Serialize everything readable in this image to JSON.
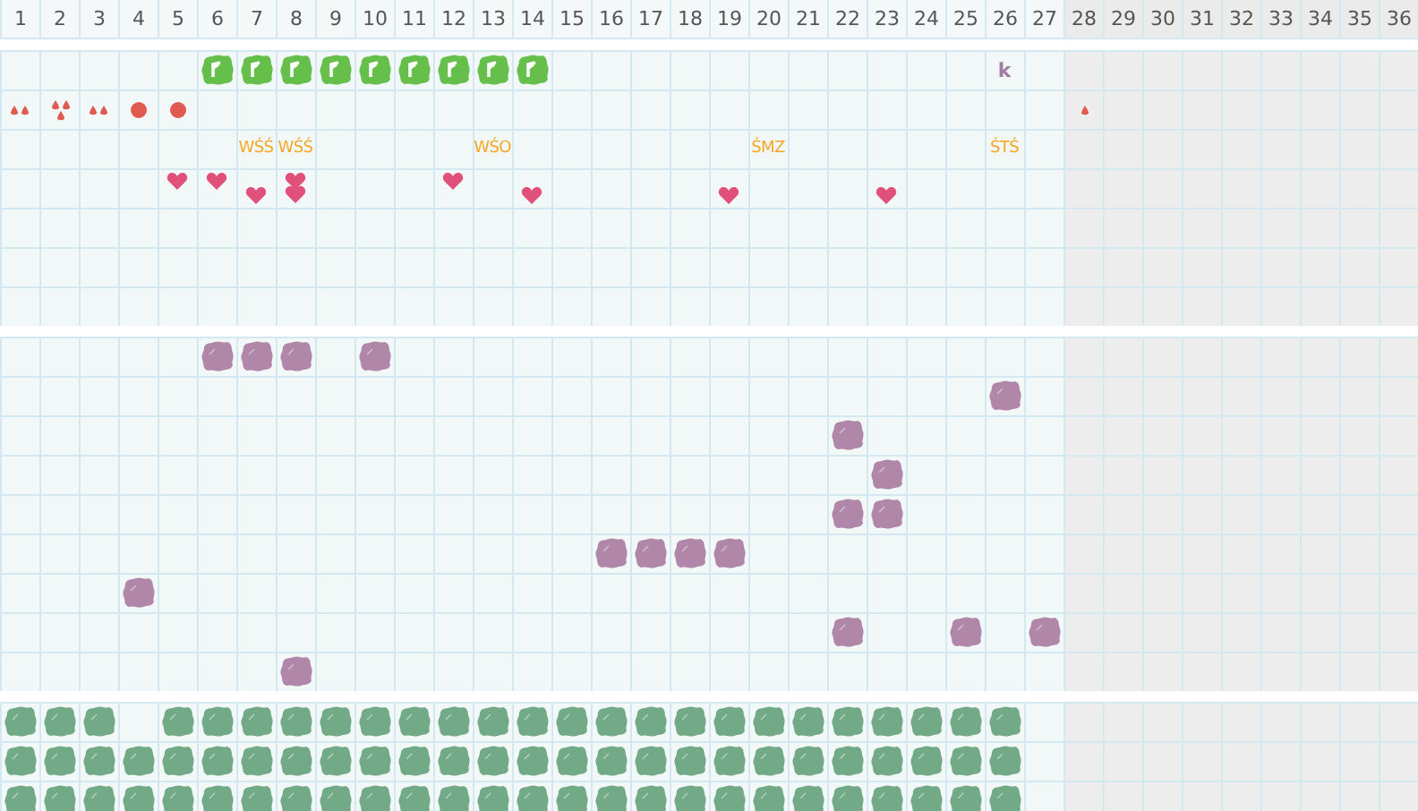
{
  "columns": [
    {
      "label": "1",
      "shaded": false
    },
    {
      "label": "2",
      "shaded": false
    },
    {
      "label": "3",
      "shaded": false
    },
    {
      "label": "4",
      "shaded": false
    },
    {
      "label": "5",
      "shaded": false
    },
    {
      "label": "6",
      "shaded": false
    },
    {
      "label": "7",
      "shaded": false
    },
    {
      "label": "8",
      "shaded": false
    },
    {
      "label": "9",
      "shaded": false
    },
    {
      "label": "10",
      "shaded": false
    },
    {
      "label": "11",
      "shaded": false
    },
    {
      "label": "12",
      "shaded": false
    },
    {
      "label": "13",
      "shaded": false
    },
    {
      "label": "14",
      "shaded": false
    },
    {
      "label": "15",
      "shaded": false
    },
    {
      "label": "16",
      "shaded": false
    },
    {
      "label": "17",
      "shaded": false
    },
    {
      "label": "18",
      "shaded": false
    },
    {
      "label": "19",
      "shaded": false
    },
    {
      "label": "20",
      "shaded": false
    },
    {
      "label": "21",
      "shaded": false
    },
    {
      "label": "22",
      "shaded": false
    },
    {
      "label": "23",
      "shaded": false
    },
    {
      "label": "24",
      "shaded": false
    },
    {
      "label": "25",
      "shaded": false
    },
    {
      "label": "26",
      "shaded": false
    },
    {
      "label": "27",
      "shaded": false
    },
    {
      "label": "28",
      "shaded": true
    },
    {
      "label": "29",
      "shaded": true
    },
    {
      "label": "30",
      "shaded": true
    },
    {
      "label": "31",
      "shaded": true
    },
    {
      "label": "32",
      "shaded": true
    },
    {
      "label": "33",
      "shaded": true
    },
    {
      "label": "34",
      "shaded": true
    },
    {
      "label": "35",
      "shaded": true
    },
    {
      "label": "36",
      "shaded": true
    }
  ],
  "sections": [
    {
      "rows": [
        {
          "cells": [
            {
              "kind": "empty"
            },
            {
              "kind": "empty"
            },
            {
              "kind": "empty"
            },
            {
              "kind": "empty"
            },
            {
              "kind": "empty"
            },
            {
              "kind": "tile"
            },
            {
              "kind": "tile"
            },
            {
              "kind": "tile"
            },
            {
              "kind": "tile"
            },
            {
              "kind": "tile"
            },
            {
              "kind": "tile"
            },
            {
              "kind": "tile"
            },
            {
              "kind": "tile"
            },
            {
              "kind": "tile"
            },
            {
              "kind": "empty"
            },
            {
              "kind": "empty"
            },
            {
              "kind": "empty"
            },
            {
              "kind": "empty"
            },
            {
              "kind": "empty"
            },
            {
              "kind": "empty"
            },
            {
              "kind": "empty"
            },
            {
              "kind": "empty"
            },
            {
              "kind": "empty"
            },
            {
              "kind": "empty"
            },
            {
              "kind": "empty"
            },
            {
              "kind": "letter",
              "text": "k"
            }
          ]
        },
        {
          "cells": [
            {
              "kind": "drop-pair"
            },
            {
              "kind": "drop-triple"
            },
            {
              "kind": "drop-pair"
            },
            {
              "kind": "dot"
            },
            {
              "kind": "dot"
            },
            {
              "kind": "empty"
            },
            {
              "kind": "empty"
            },
            {
              "kind": "empty"
            },
            {
              "kind": "empty"
            },
            {
              "kind": "empty"
            },
            {
              "kind": "empty"
            },
            {
              "kind": "empty"
            },
            {
              "kind": "empty"
            },
            {
              "kind": "empty"
            },
            {
              "kind": "empty"
            },
            {
              "kind": "empty"
            },
            {
              "kind": "empty"
            },
            {
              "kind": "empty"
            },
            {
              "kind": "empty"
            },
            {
              "kind": "empty"
            },
            {
              "kind": "empty"
            },
            {
              "kind": "empty"
            },
            {
              "kind": "empty"
            },
            {
              "kind": "empty"
            },
            {
              "kind": "empty"
            },
            {
              "kind": "empty"
            },
            {
              "kind": "empty"
            },
            {
              "kind": "drop"
            }
          ]
        },
        {
          "cells": [
            {
              "kind": "empty"
            },
            {
              "kind": "empty"
            },
            {
              "kind": "empty"
            },
            {
              "kind": "empty"
            },
            {
              "kind": "empty"
            },
            {
              "kind": "empty"
            },
            {
              "kind": "label",
              "text": "WŚŚ"
            },
            {
              "kind": "label",
              "text": "WŚŚ"
            },
            {
              "kind": "empty"
            },
            {
              "kind": "empty"
            },
            {
              "kind": "empty"
            },
            {
              "kind": "empty"
            },
            {
              "kind": "label",
              "text": "WŚO"
            },
            {
              "kind": "empty"
            },
            {
              "kind": "empty"
            },
            {
              "kind": "empty"
            },
            {
              "kind": "empty"
            },
            {
              "kind": "empty"
            },
            {
              "kind": "empty"
            },
            {
              "kind": "label",
              "text": "ŚMZ"
            },
            {
              "kind": "empty"
            },
            {
              "kind": "empty"
            },
            {
              "kind": "empty"
            },
            {
              "kind": "empty"
            },
            {
              "kind": "empty"
            },
            {
              "kind": "label",
              "text": "ŚTŚ"
            }
          ]
        },
        {
          "cells": [
            {
              "kind": "empty"
            },
            {
              "kind": "empty"
            },
            {
              "kind": "empty"
            },
            {
              "kind": "empty"
            },
            {
              "kind": "heart"
            },
            {
              "kind": "heart"
            },
            {
              "kind": "heart-low"
            },
            {
              "kind": "heart-pair"
            },
            {
              "kind": "empty"
            },
            {
              "kind": "empty"
            },
            {
              "kind": "empty"
            },
            {
              "kind": "heart"
            },
            {
              "kind": "empty"
            },
            {
              "kind": "heart-low"
            },
            {
              "kind": "empty"
            },
            {
              "kind": "empty"
            },
            {
              "kind": "empty"
            },
            {
              "kind": "empty"
            },
            {
              "kind": "heart-low"
            },
            {
              "kind": "empty"
            },
            {
              "kind": "empty"
            },
            {
              "kind": "empty"
            },
            {
              "kind": "heart-low"
            }
          ]
        },
        {},
        {},
        {}
      ]
    },
    {
      "rows": [
        {
          "cells": [
            {
              "kind": "empty"
            },
            {
              "kind": "empty"
            },
            {
              "kind": "empty"
            },
            {
              "kind": "empty"
            },
            {
              "kind": "empty"
            },
            {
              "kind": "blob"
            },
            {
              "kind": "blob"
            },
            {
              "kind": "blob"
            },
            {
              "kind": "empty"
            },
            {
              "kind": "blob"
            }
          ]
        },
        {
          "cells": [
            {
              "kind": "empty"
            },
            {
              "kind": "empty"
            },
            {
              "kind": "empty"
            },
            {
              "kind": "empty"
            },
            {
              "kind": "empty"
            },
            {
              "kind": "empty"
            },
            {
              "kind": "empty"
            },
            {
              "kind": "empty"
            },
            {
              "kind": "empty"
            },
            {
              "kind": "empty"
            },
            {
              "kind": "empty"
            },
            {
              "kind": "empty"
            },
            {
              "kind": "empty"
            },
            {
              "kind": "empty"
            },
            {
              "kind": "empty"
            },
            {
              "kind": "empty"
            },
            {
              "kind": "empty"
            },
            {
              "kind": "empty"
            },
            {
              "kind": "empty"
            },
            {
              "kind": "empty"
            },
            {
              "kind": "empty"
            },
            {
              "kind": "empty"
            },
            {
              "kind": "empty"
            },
            {
              "kind": "empty"
            },
            {
              "kind": "empty"
            },
            {
              "kind": "blob"
            }
          ]
        },
        {
          "cells": [
            {
              "kind": "empty"
            },
            {
              "kind": "empty"
            },
            {
              "kind": "empty"
            },
            {
              "kind": "empty"
            },
            {
              "kind": "empty"
            },
            {
              "kind": "empty"
            },
            {
              "kind": "empty"
            },
            {
              "kind": "empty"
            },
            {
              "kind": "empty"
            },
            {
              "kind": "empty"
            },
            {
              "kind": "empty"
            },
            {
              "kind": "empty"
            },
            {
              "kind": "empty"
            },
            {
              "kind": "empty"
            },
            {
              "kind": "empty"
            },
            {
              "kind": "empty"
            },
            {
              "kind": "empty"
            },
            {
              "kind": "empty"
            },
            {
              "kind": "empty"
            },
            {
              "kind": "empty"
            },
            {
              "kind": "empty"
            },
            {
              "kind": "blob"
            }
          ]
        },
        {
          "cells": [
            {
              "kind": "empty"
            },
            {
              "kind": "empty"
            },
            {
              "kind": "empty"
            },
            {
              "kind": "empty"
            },
            {
              "kind": "empty"
            },
            {
              "kind": "empty"
            },
            {
              "kind": "empty"
            },
            {
              "kind": "empty"
            },
            {
              "kind": "empty"
            },
            {
              "kind": "empty"
            },
            {
              "kind": "empty"
            },
            {
              "kind": "empty"
            },
            {
              "kind": "empty"
            },
            {
              "kind": "empty"
            },
            {
              "kind": "empty"
            },
            {
              "kind": "empty"
            },
            {
              "kind": "empty"
            },
            {
              "kind": "empty"
            },
            {
              "kind": "empty"
            },
            {
              "kind": "empty"
            },
            {
              "kind": "empty"
            },
            {
              "kind": "empty"
            },
            {
              "kind": "blob"
            }
          ]
        },
        {
          "cells": [
            {
              "kind": "empty"
            },
            {
              "kind": "empty"
            },
            {
              "kind": "empty"
            },
            {
              "kind": "empty"
            },
            {
              "kind": "empty"
            },
            {
              "kind": "empty"
            },
            {
              "kind": "empty"
            },
            {
              "kind": "empty"
            },
            {
              "kind": "empty"
            },
            {
              "kind": "empty"
            },
            {
              "kind": "empty"
            },
            {
              "kind": "empty"
            },
            {
              "kind": "empty"
            },
            {
              "kind": "empty"
            },
            {
              "kind": "empty"
            },
            {
              "kind": "empty"
            },
            {
              "kind": "empty"
            },
            {
              "kind": "empty"
            },
            {
              "kind": "empty"
            },
            {
              "kind": "empty"
            },
            {
              "kind": "empty"
            },
            {
              "kind": "blob"
            },
            {
              "kind": "blob"
            }
          ]
        },
        {
          "cells": [
            {
              "kind": "empty"
            },
            {
              "kind": "empty"
            },
            {
              "kind": "empty"
            },
            {
              "kind": "empty"
            },
            {
              "kind": "empty"
            },
            {
              "kind": "empty"
            },
            {
              "kind": "empty"
            },
            {
              "kind": "empty"
            },
            {
              "kind": "empty"
            },
            {
              "kind": "empty"
            },
            {
              "kind": "empty"
            },
            {
              "kind": "empty"
            },
            {
              "kind": "empty"
            },
            {
              "kind": "empty"
            },
            {
              "kind": "empty"
            },
            {
              "kind": "blob"
            },
            {
              "kind": "blob"
            },
            {
              "kind": "blob"
            },
            {
              "kind": "blob"
            }
          ]
        },
        {
          "cells": [
            {
              "kind": "empty"
            },
            {
              "kind": "empty"
            },
            {
              "kind": "empty"
            },
            {
              "kind": "blob"
            }
          ]
        },
        {
          "cells": [
            {
              "kind": "empty"
            },
            {
              "kind": "empty"
            },
            {
              "kind": "empty"
            },
            {
              "kind": "empty"
            },
            {
              "kind": "empty"
            },
            {
              "kind": "empty"
            },
            {
              "kind": "empty"
            },
            {
              "kind": "empty"
            },
            {
              "kind": "empty"
            },
            {
              "kind": "empty"
            },
            {
              "kind": "empty"
            },
            {
              "kind": "empty"
            },
            {
              "kind": "empty"
            },
            {
              "kind": "empty"
            },
            {
              "kind": "empty"
            },
            {
              "kind": "empty"
            },
            {
              "kind": "empty"
            },
            {
              "kind": "empty"
            },
            {
              "kind": "empty"
            },
            {
              "kind": "empty"
            },
            {
              "kind": "empty"
            },
            {
              "kind": "blob"
            },
            {
              "kind": "empty"
            },
            {
              "kind": "empty"
            },
            {
              "kind": "blob"
            },
            {
              "kind": "empty"
            },
            {
              "kind": "blob"
            }
          ]
        },
        {
          "cells": [
            {
              "kind": "empty"
            },
            {
              "kind": "empty"
            },
            {
              "kind": "empty"
            },
            {
              "kind": "empty"
            },
            {
              "kind": "empty"
            },
            {
              "kind": "empty"
            },
            {
              "kind": "empty"
            },
            {
              "kind": "blob"
            }
          ]
        }
      ]
    },
    {
      "rows": [
        {
          "cells": [
            {
              "kind": "leaf"
            },
            {
              "kind": "leaf"
            },
            {
              "kind": "leaf"
            },
            {
              "kind": "empty"
            },
            {
              "kind": "leaf"
            },
            {
              "kind": "leaf"
            },
            {
              "kind": "leaf"
            },
            {
              "kind": "leaf"
            },
            {
              "kind": "leaf"
            },
            {
              "kind": "leaf"
            },
            {
              "kind": "leaf"
            },
            {
              "kind": "leaf"
            },
            {
              "kind": "leaf"
            },
            {
              "kind": "leaf"
            },
            {
              "kind": "leaf"
            },
            {
              "kind": "leaf"
            },
            {
              "kind": "leaf"
            },
            {
              "kind": "leaf"
            },
            {
              "kind": "leaf"
            },
            {
              "kind": "leaf"
            },
            {
              "kind": "leaf"
            },
            {
              "kind": "leaf"
            },
            {
              "kind": "leaf"
            },
            {
              "kind": "leaf"
            },
            {
              "kind": "leaf"
            },
            {
              "kind": "leaf"
            }
          ]
        },
        {
          "cells": [
            {
              "kind": "leaf"
            },
            {
              "kind": "leaf"
            },
            {
              "kind": "leaf"
            },
            {
              "kind": "leaf"
            },
            {
              "kind": "leaf"
            },
            {
              "kind": "leaf"
            },
            {
              "kind": "leaf"
            },
            {
              "kind": "leaf"
            },
            {
              "kind": "leaf"
            },
            {
              "kind": "leaf"
            },
            {
              "kind": "leaf"
            },
            {
              "kind": "leaf"
            },
            {
              "kind": "leaf"
            },
            {
              "kind": "leaf"
            },
            {
              "kind": "leaf"
            },
            {
              "kind": "leaf"
            },
            {
              "kind": "leaf"
            },
            {
              "kind": "leaf"
            },
            {
              "kind": "leaf"
            },
            {
              "kind": "leaf"
            },
            {
              "kind": "leaf"
            },
            {
              "kind": "leaf"
            },
            {
              "kind": "leaf"
            },
            {
              "kind": "leaf"
            },
            {
              "kind": "leaf"
            },
            {
              "kind": "leaf"
            }
          ]
        },
        {
          "cells": [
            {
              "kind": "leaf"
            },
            {
              "kind": "leaf"
            },
            {
              "kind": "leaf"
            },
            {
              "kind": "leaf"
            },
            {
              "kind": "leaf"
            },
            {
              "kind": "leaf"
            },
            {
              "kind": "leaf"
            },
            {
              "kind": "leaf"
            },
            {
              "kind": "leaf"
            },
            {
              "kind": "leaf"
            },
            {
              "kind": "leaf"
            },
            {
              "kind": "leaf"
            },
            {
              "kind": "leaf"
            },
            {
              "kind": "leaf"
            },
            {
              "kind": "leaf"
            },
            {
              "kind": "leaf"
            },
            {
              "kind": "leaf"
            },
            {
              "kind": "leaf"
            },
            {
              "kind": "leaf"
            },
            {
              "kind": "leaf"
            },
            {
              "kind": "leaf"
            },
            {
              "kind": "leaf"
            },
            {
              "kind": "leaf"
            },
            {
              "kind": "leaf"
            },
            {
              "kind": "leaf"
            },
            {
              "kind": "leaf"
            }
          ]
        }
      ]
    }
  ]
}
